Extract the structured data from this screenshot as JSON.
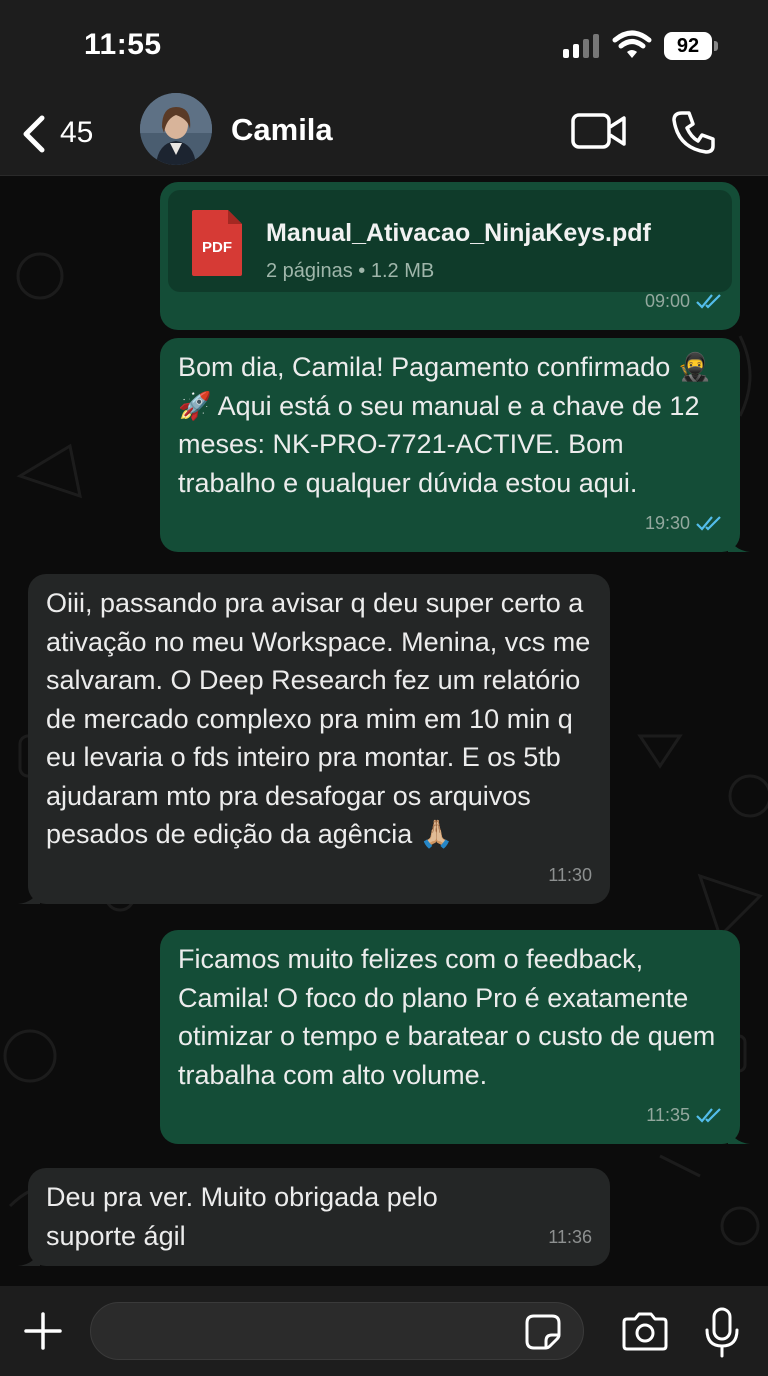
{
  "status_bar": {
    "time": "11:55",
    "battery": "92"
  },
  "header": {
    "back_count": "45",
    "contact_name": "Camila"
  },
  "messages": [
    {
      "type": "document",
      "direction": "outgoing",
      "file_name": "Manual_Ativacao_NinjaKeys.pdf",
      "file_info": "2 páginas • 1.2 MB",
      "file_icon_label": "PDF",
      "time": "09:00",
      "status": "read"
    },
    {
      "type": "text",
      "direction": "outgoing",
      "text": "Bom dia, Camila! Pagamento confirmado 🥷🚀 Aqui está o seu manual e a chave de 12 meses: NK-PRO-7721-ACTIVE. Bom trabalho e qualquer dúvida estou aqui.",
      "time": "19:30",
      "status": "read"
    },
    {
      "type": "text",
      "direction": "incoming",
      "text": "Oiii, passando pra avisar q deu super certo a ativação no meu Workspace. Menina, vcs me salvaram. O Deep Research fez um relatório de mercado complexo pra mim em 10 min q eu levaria o fds inteiro pra montar.  E os 5tb ajudaram mto pra desafogar os arquivos pesados de edição da agência 🙏🏼",
      "time": "11:30"
    },
    {
      "type": "text",
      "direction": "outgoing",
      "text": "Ficamos muito felizes com o feedback, Camila! O foco do plano Pro é exatamente otimizar o tempo e baratear o custo de quem trabalha com alto volume.",
      "time": "11:35",
      "status": "read"
    },
    {
      "type": "text",
      "direction": "incoming",
      "text": "Deu pra ver. Muito obrigada pelo suporte ágil",
      "time": "11:36"
    }
  ],
  "input": {
    "value": "",
    "placeholder": ""
  },
  "colors": {
    "outgoing_bubble": "#144d37",
    "incoming_bubble": "#242626",
    "read_ticks": "#53bdeb",
    "background": "#0c0c0c"
  },
  "icons": [
    "chevron-left-icon",
    "video-call-icon",
    "phone-icon",
    "pdf-icon",
    "double-check-icon",
    "plus-icon",
    "sticker-icon",
    "camera-icon",
    "microphone-icon"
  ]
}
